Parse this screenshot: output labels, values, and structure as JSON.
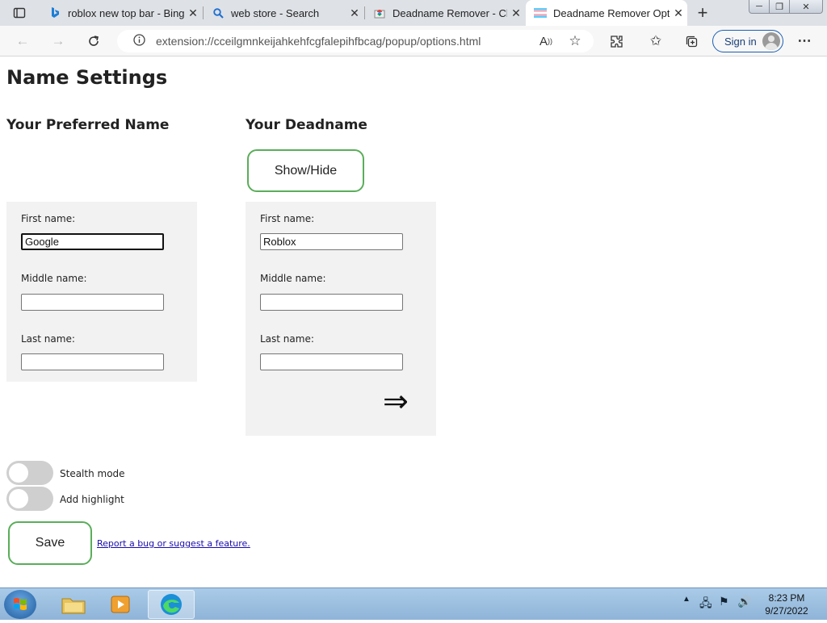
{
  "browser": {
    "tabs": [
      {
        "title": "roblox new top bar - Bing",
        "icon": "bing-icon"
      },
      {
        "title": "web store - Search",
        "icon": "search-icon"
      },
      {
        "title": "Deadname Remover - Ch",
        "icon": "chrome-store-icon"
      },
      {
        "title": "Deadname Remover Opti",
        "icon": "trans-flag-icon",
        "active": true
      }
    ],
    "url": "extension://cceilgmnkeijahkehfcgfalepihfbcag/popup/options.html",
    "sign_in_label": "Sign in"
  },
  "page": {
    "title": "Name Settings",
    "preferred": {
      "heading": "Your Preferred Name",
      "first_label": "First name:",
      "first_value": "Google",
      "middle_label": "Middle name:",
      "middle_value": "",
      "last_label": "Last name:",
      "last_value": ""
    },
    "deadname": {
      "heading": "Your Deadname",
      "show_hide_label": "Show/Hide",
      "first_label": "First name:",
      "first_value": "Roblox",
      "middle_label": "Middle name:",
      "middle_value": "",
      "last_label": "Last name:",
      "last_value": "",
      "arrow": "⇒"
    },
    "stealth_label": "Stealth mode",
    "stealth_on": false,
    "highlight_label": "Add highlight",
    "highlight_on": false,
    "save_label": "Save",
    "report_link": "Report a bug or suggest a feature."
  },
  "taskbar": {
    "time": "8:23 PM",
    "date": "9/27/2022"
  }
}
